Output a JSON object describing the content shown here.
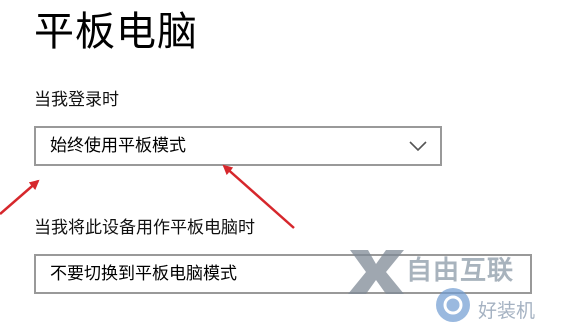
{
  "page": {
    "title": "平板电脑"
  },
  "sections": [
    {
      "label": "当我登录时",
      "dropdown": {
        "selected": "始终使用平板模式",
        "icon": "chevron-down-icon"
      }
    },
    {
      "label": "当我将此设备用作平板电脑时",
      "dropdown": {
        "selected": "不要切换到平板电脑模式",
        "icon": "chevron-down-icon"
      }
    }
  ],
  "annotations": {
    "arrow_color": "#d6272c"
  },
  "watermark": {
    "brand": "自由互联",
    "site": "好装机"
  },
  "colors": {
    "border": "#999999",
    "text": "#000000"
  }
}
